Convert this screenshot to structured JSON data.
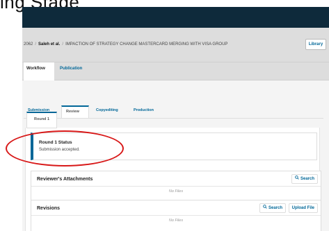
{
  "page": {
    "top_fragment": "ing Stage"
  },
  "breadcrumb": {
    "id": "2062",
    "separator": "/",
    "author": "Saleh et al.",
    "title": "IMPACTION OF STRATEGY CHANGE MASTERCARD MERGING WITH VISA GROUP",
    "library_label": "Library"
  },
  "main_tabs": [
    {
      "label": "Workflow"
    },
    {
      "label": "Publication"
    }
  ],
  "stage_tabs": [
    {
      "label": "Submission"
    },
    {
      "label": "Review"
    },
    {
      "label": "Copyediting"
    },
    {
      "label": "Production"
    }
  ],
  "round_tab": {
    "label": "Round 1"
  },
  "status": {
    "title": "Round 1 Status",
    "text": "Submission accepted."
  },
  "reviewer_attachments": {
    "title": "Reviewer's Attachments",
    "search_label": "Search",
    "empty_text": "No Files"
  },
  "revisions": {
    "title": "Revisions",
    "search_label": "Search",
    "upload_label": "Upload File",
    "empty_text": "No Files"
  },
  "colors": {
    "topbar": "#0e2a3b",
    "accent": "#006798",
    "highlight_ring": "#d81818"
  },
  "icons": [
    "search-icon"
  ]
}
